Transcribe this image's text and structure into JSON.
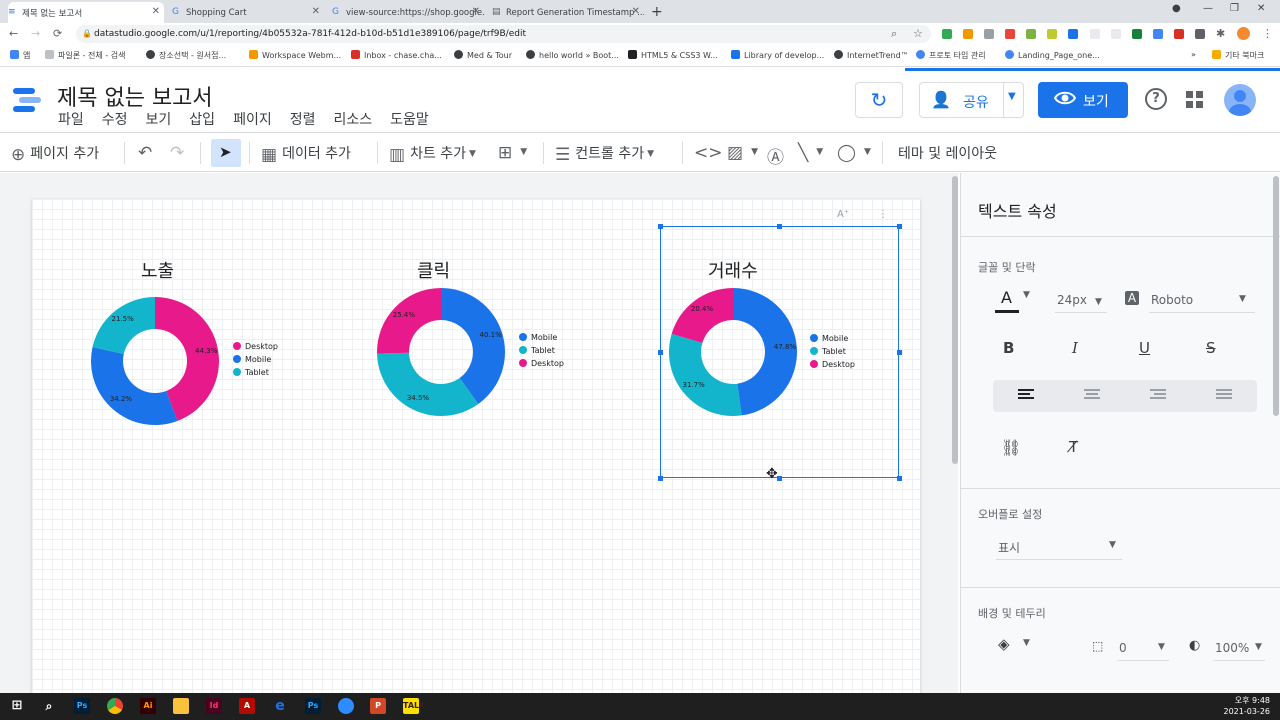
{
  "browser": {
    "tabs": [
      {
        "label": "제목 없는 보고서"
      },
      {
        "label": "Shopping Cart"
      },
      {
        "label": "view-source:https://shop.google..."
      },
      {
        "label": "Report Generation Timestamp ..."
      }
    ],
    "url": "datastudio.google.com/u/1/reporting/4b05532a-781f-412d-b10d-b51d1e389106/page/trf9B/edit",
    "bookmarks": [
      {
        "label": "앱"
      },
      {
        "label": "파일론 - 전체 - 검색"
      },
      {
        "label": "장소선택 - 원서접..."
      },
      {
        "label": "Workspace Webm..."
      },
      {
        "label": "Inbox - chase.cha..."
      },
      {
        "label": "Med & Tour"
      },
      {
        "label": "hello world » Boot..."
      },
      {
        "label": "HTML5 & CSS3 W..."
      },
      {
        "label": "Library of develop..."
      },
      {
        "label": "InternetTrend™"
      },
      {
        "label": "프로토 타입 관리"
      },
      {
        "label": "Landing_Page_one..."
      },
      {
        "label": "기타 북마크"
      }
    ]
  },
  "app": {
    "title": "제목 없는 보고서",
    "menu": [
      "파일",
      "수정",
      "보기",
      "삽입",
      "페이지",
      "정렬",
      "리소스",
      "도움말"
    ],
    "share_label": "공유",
    "view_label": "보기"
  },
  "toolbar": {
    "add_page": "페이지 추가",
    "add_data": "데이터 추가",
    "add_chart": "차트 추가",
    "add_control": "컨트롤 추가",
    "theme_layout": "테마 및 레이아웃"
  },
  "charts": [
    {
      "title": "노출"
    },
    {
      "title": "클릭"
    },
    {
      "title": "거래수"
    }
  ],
  "chart_data": [
    {
      "type": "pie",
      "title": "노출",
      "categories": [
        "Desktop",
        "Mobile",
        "Tablet"
      ],
      "values": [
        44.3,
        34.2,
        21.5
      ],
      "labels": [
        "44.3%",
        "34.2%",
        "21.5%"
      ],
      "colors": [
        "#e8198b",
        "#1a73e8",
        "#12b5cb"
      ],
      "legend": "right"
    },
    {
      "type": "pie",
      "title": "클릭",
      "categories": [
        "Mobile",
        "Tablet",
        "Desktop"
      ],
      "values": [
        40.1,
        34.5,
        25.4
      ],
      "labels": [
        "40.1%",
        "34.5%",
        "25.4%"
      ],
      "colors": [
        "#1a73e8",
        "#12b5cb",
        "#e8198b"
      ],
      "legend": "right"
    },
    {
      "type": "pie",
      "title": "거래수",
      "categories": [
        "Mobile",
        "Tablet",
        "Desktop"
      ],
      "values": [
        47.8,
        31.7,
        20.4
      ],
      "labels": [
        "47.8%",
        "31.7%",
        "20.4%"
      ],
      "colors": [
        "#1a73e8",
        "#12b5cb",
        "#e8198b"
      ],
      "legend": "right"
    }
  ],
  "panel": {
    "title": "텍스트 속성",
    "font_section": "글꼴 및 단락",
    "font_size": "24px",
    "font_family": "Roboto",
    "overflow_section": "오버플로 설정",
    "overflow_value": "표시",
    "bg_section": "배경 및 테두리",
    "border_width": "0",
    "opacity": "100%"
  },
  "taskbar": {
    "time": "오후 9:48",
    "date": "2021-03-26"
  }
}
